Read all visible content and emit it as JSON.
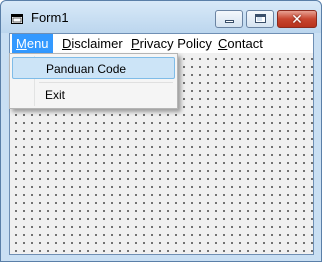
{
  "window": {
    "title": "Form1",
    "minimize_icon": "minimize-icon",
    "maximize_icon": "maximize-icon",
    "close_glyph": "✕"
  },
  "menubar": {
    "items": [
      {
        "mnemonic": "M",
        "rest": "enu"
      },
      {
        "mnemonic": "D",
        "rest": "isclaimer"
      },
      {
        "mnemonic": "P",
        "rest": "rivacy Policy"
      },
      {
        "mnemonic": "C",
        "rest": "ontact"
      }
    ]
  },
  "dropdown": {
    "items": [
      {
        "label": "Panduan Code"
      },
      {
        "label": "Exit"
      }
    ]
  },
  "colors": {
    "menu_active": "#3399ff",
    "highlight": "#cce4f7",
    "close_button": "#c8452f"
  }
}
